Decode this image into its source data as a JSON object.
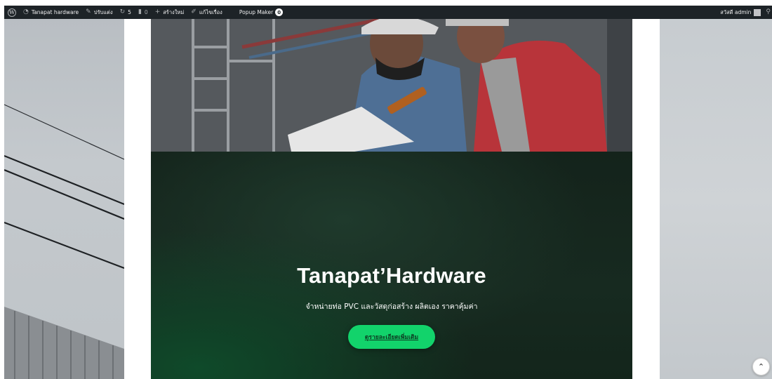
{
  "adminbar": {
    "site_name": "Tanapat hardware",
    "customize": "ปรับแต่ง",
    "updates_count": "5",
    "comments_count": "0",
    "new": "สร้างใหม่",
    "edit": "แก้ไขเรื่อง",
    "popup_maker": "Popup Maker",
    "popup_count": "0",
    "greeting": "สวัสดี admin",
    "icons": [
      "wordpress-icon",
      "dashboard-icon",
      "brush-icon",
      "updates-icon",
      "comment-icon",
      "plus-icon",
      "pencil-icon",
      "user-avatar"
    ]
  },
  "hero": {
    "title": "Tanapat’Hardware",
    "subtitle": "จำหน่ายท่อ PVC และวัสดุก่อสร้าง ผลิตเอง ราคาคุ้มค่า",
    "button": "ดูรายละเอียดเพิ่มเติม",
    "accent_color": "#12d36b",
    "panel_color": "#172a20"
  },
  "scroll_top": {
    "icon": "chevron-up-icon"
  }
}
